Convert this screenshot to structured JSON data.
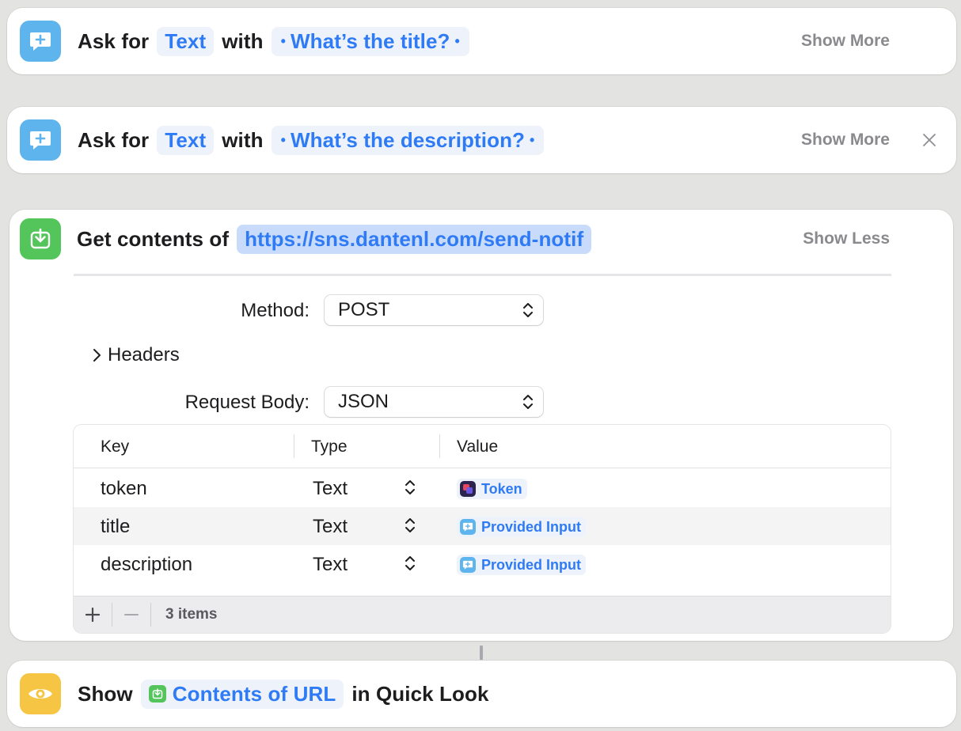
{
  "colors": {
    "background": "#e3e3e1",
    "accent_blue": "#2f7bf5",
    "ask_icon": "#5eb4ec",
    "download_icon": "#53c55a",
    "eye_icon": "#f6c544",
    "token_icon": "#3b2a7a"
  },
  "actions": [
    {
      "icon": "ask-for-input-icon",
      "verb": "Ask for",
      "type_token": "Text",
      "with": "with",
      "prompt": "What’s the title?",
      "toggle": "Show More"
    },
    {
      "icon": "ask-for-input-icon",
      "verb": "Ask for",
      "type_token": "Text",
      "with": "with",
      "prompt": "What’s the description?",
      "toggle": "Show More",
      "close_icon": "close-icon"
    },
    {
      "icon": "download-icon",
      "verb": "Get contents of",
      "url": "https://sns.dantenl.com/send-notif",
      "toggle": "Show Less",
      "method_label": "Method:",
      "method_value": "POST",
      "headers_label": "Headers",
      "body_label": "Request Body:",
      "body_value": "JSON",
      "table": {
        "columns": [
          "Key",
          "Type",
          "Value"
        ],
        "rows": [
          {
            "key": "token",
            "type": "Text",
            "value": "Token",
            "value_icon": "shortcuts-icon"
          },
          {
            "key": "title",
            "type": "Text",
            "value": "Provided Input",
            "value_icon": "ask-for-input-icon"
          },
          {
            "key": "description",
            "type": "Text",
            "value": "Provided Input",
            "value_icon": "ask-for-input-icon"
          }
        ],
        "footer_count": "3 items"
      }
    },
    {
      "icon": "eye-icon",
      "verb": "Show",
      "token": "Contents of URL",
      "token_icon": "download-icon",
      "suffix": "in Quick Look"
    }
  ]
}
